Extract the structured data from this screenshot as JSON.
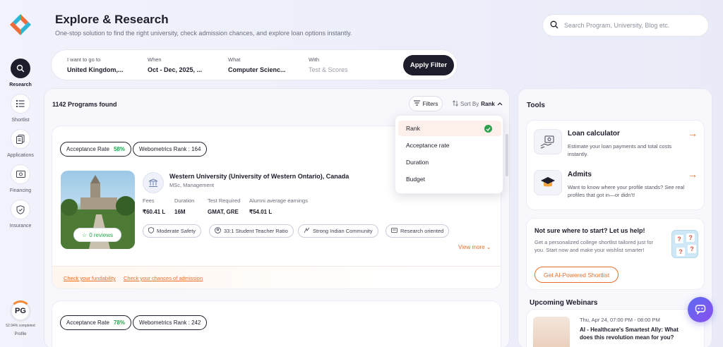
{
  "header": {
    "title": "Explore & Research",
    "subtitle": "One-stop solution to find the right university, check admission chances, and explore loan options instantly.",
    "search_placeholder": "Search Program, University, Blog etc."
  },
  "sidebar": {
    "items": [
      {
        "label": "Research",
        "icon": "search-icon",
        "active": true
      },
      {
        "label": "Shortlist",
        "icon": "list-icon"
      },
      {
        "label": "Applications",
        "icon": "documents-icon"
      },
      {
        "label": "Financing",
        "icon": "money-icon"
      },
      {
        "label": "Insurance",
        "icon": "shield-icon"
      }
    ],
    "profile": {
      "initials": "PG",
      "completion": "52.94% completed",
      "label": "Profile",
      "progress": 0.5294
    }
  },
  "filterbar": {
    "fields": [
      {
        "label": "I want to go to",
        "value": "United Kingdom,..."
      },
      {
        "label": "When",
        "value": "Oct - Dec, 2025, ..."
      },
      {
        "label": "What",
        "value": "Computer Scienc..."
      },
      {
        "label": "With",
        "value": "Test & Scores"
      }
    ],
    "apply_label": "Apply Filter"
  },
  "programs": {
    "count_label": "1142 Programs found",
    "filters_label": "Filters",
    "sort_prefix": "Sort By",
    "sort_value": "Rank",
    "sort_options": [
      {
        "label": "Rank",
        "selected": true
      },
      {
        "label": "Acceptance rate"
      },
      {
        "label": "Duration"
      },
      {
        "label": "Budget"
      }
    ],
    "cards": [
      {
        "acceptance_label": "Acceptance Rate",
        "acceptance_value": "58%",
        "webometrics": "Webometrics Rank : 164",
        "reviews": "0 reviews",
        "name": "Western University (University of Western Ontario), Canada",
        "course": "MSc, Management",
        "stats": [
          {
            "label": "Fees",
            "value": "₹60.41 L"
          },
          {
            "label": "Duration",
            "value": "16M"
          },
          {
            "label": "Test Required",
            "value": "GMAT, GRE"
          },
          {
            "label": "Alumni average earnings",
            "value": "₹54.01 L"
          }
        ],
        "tags": [
          "Moderate Safety",
          "33:1 Student Teacher Ratio",
          "Strong Indian Community",
          "Research oriented"
        ],
        "view_more": "View more",
        "links": [
          "Check your fundability",
          "Check your chances of admission"
        ]
      },
      {
        "acceptance_label": "Acceptance Rate",
        "acceptance_value": "78%",
        "webometrics": "Webometrics Rank : 242"
      }
    ]
  },
  "tools": {
    "title": "Tools",
    "items": [
      {
        "name": "Loan calculator",
        "desc": "Estimate your loan payments and total costs instantly.",
        "icon": "loan-calculator-icon"
      },
      {
        "name": "Admits",
        "desc": "Want to know where your profile stands? See real profiles that got in—or didn't!",
        "icon": "graduation-cap-icon"
      }
    ],
    "help": {
      "title": "Not sure where to start? Let us help!",
      "desc": "Get a personalized college shortlist tailored just for you. Start now and make your wishlist smarter!",
      "button": "Get AI-Powered Shortlist"
    },
    "webinars": {
      "title": "Upcoming Webinars",
      "items": [
        {
          "date": "Thu, Apr 24, 07:00 PM - 08:00 PM",
          "name": "AI - Healthcare's Smartest Ally: What does this revolution mean for you?"
        }
      ]
    }
  },
  "colors": {
    "accent": "#e86e2c",
    "dark": "#1d1d2b",
    "success": "#2ca24d"
  }
}
